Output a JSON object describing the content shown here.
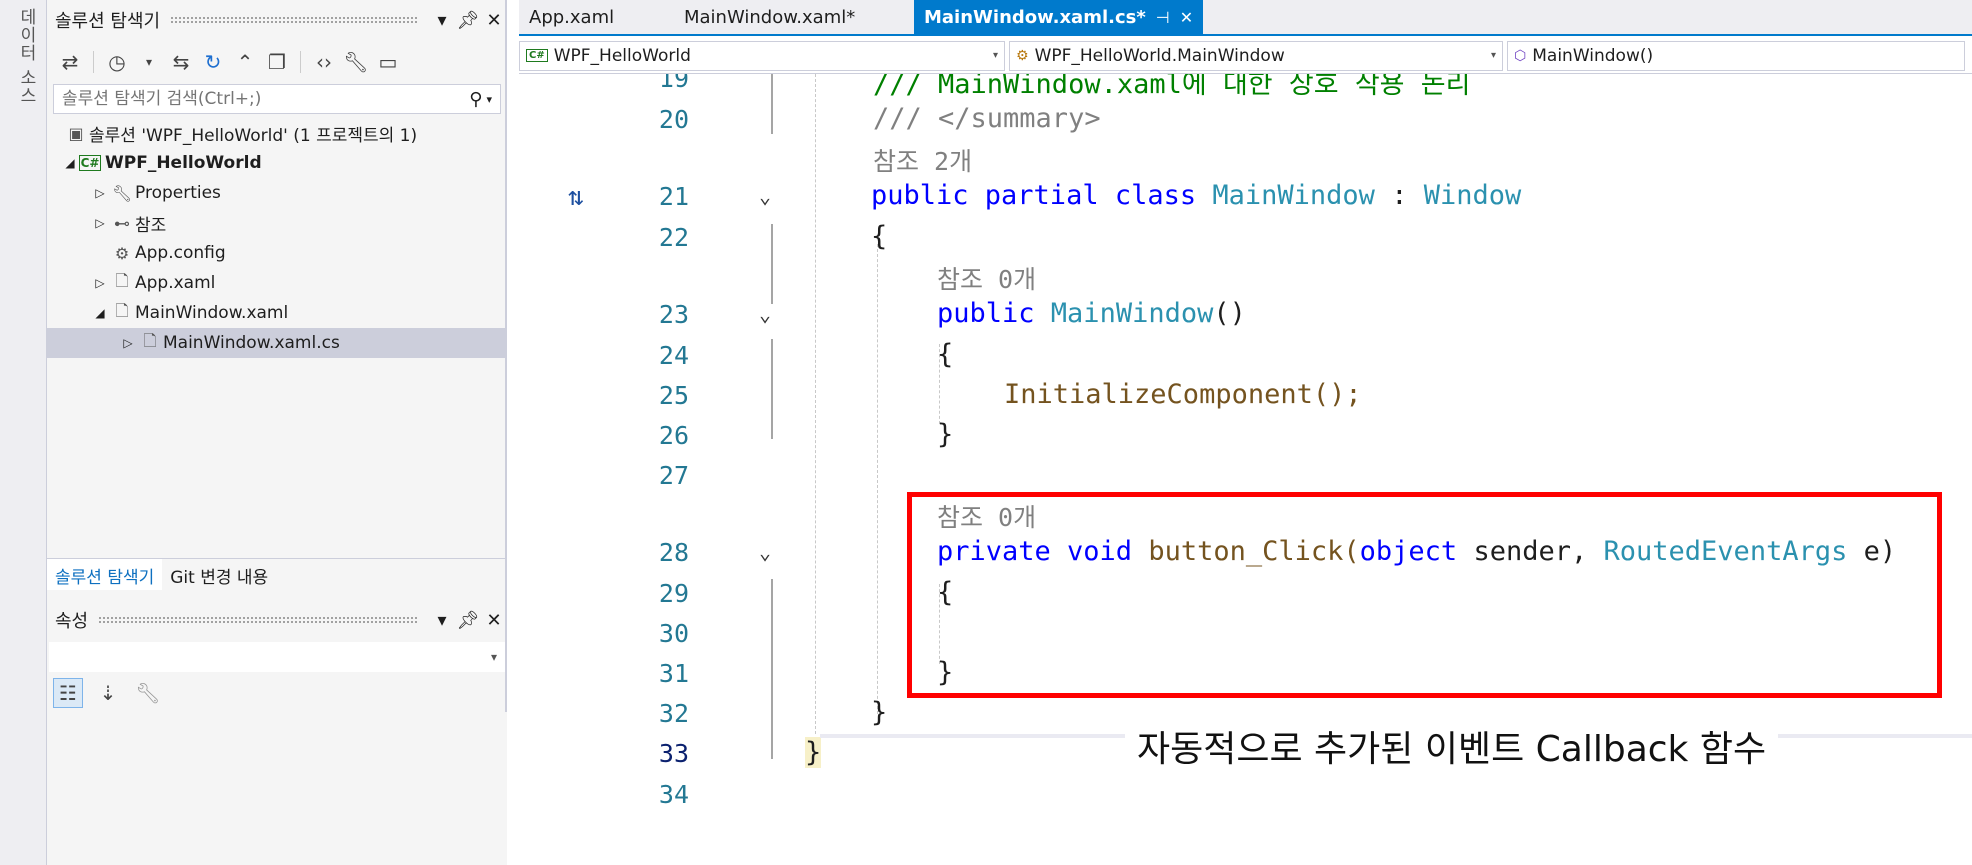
{
  "left_strip": {
    "label": "데이터 소스"
  },
  "solution_explorer": {
    "title": "솔루션 탐색기",
    "toolbar_icons": [
      "switch-views-icon",
      "history-icon",
      "sync-icon",
      "refresh-icon",
      "collapse-all-icon",
      "show-all-files-icon",
      "code-view-icon",
      "properties-wrench-icon",
      "preview-icon"
    ],
    "search_placeholder": "솔루션 탐색기 검색(Ctrl+;)",
    "tree": [
      {
        "label": "솔루션 'WPF_HelloWorld' (1 프로젝트의 1)",
        "icon": "solution-icon"
      },
      {
        "label": "WPF_HelloWorld",
        "icon": "csharp-project-icon",
        "bold": true
      },
      {
        "label": "Properties",
        "icon": "wrench-icon"
      },
      {
        "label": "참조",
        "icon": "references-icon"
      },
      {
        "label": "App.config",
        "icon": "config-file-icon"
      },
      {
        "label": "App.xaml",
        "icon": "xaml-file-icon"
      },
      {
        "label": "MainWindow.xaml",
        "icon": "xaml-file-icon"
      },
      {
        "label": "MainWindow.xaml.cs",
        "icon": "cs-file-icon",
        "selected": true
      }
    ],
    "tabs": [
      "솔루션 탐색기",
      "Git 변경 내용"
    ]
  },
  "properties_panel": {
    "title": "속성"
  },
  "editor": {
    "tabs": [
      {
        "label": "App.xaml",
        "active": false
      },
      {
        "label": "MainWindow.xaml*",
        "active": false
      },
      {
        "label": "MainWindow.xaml.cs*",
        "active": true
      }
    ],
    "nav": {
      "project": "WPF_HelloWorld",
      "type": "WPF_HelloWorld.MainWindow",
      "member": "MainWindow()"
    },
    "line_numbers": [
      "19",
      "20",
      "21",
      "22",
      "23",
      "24",
      "25",
      "26",
      "27",
      "28",
      "29",
      "30",
      "31",
      "32",
      "33",
      "34"
    ],
    "codelens": {
      "class_refs": "참조 2개",
      "ctor_refs": "참조 0개",
      "method_refs": "참조 0개"
    },
    "code": {
      "l19": "/// MainWindow.xaml에 대한 상호 작용 논리",
      "l20": "/// </summary>",
      "l21_kw": "public partial class ",
      "l21_type": "MainWindow",
      "l21_sep": " : ",
      "l21_base": "Window",
      "l22": "{",
      "l23_kw": "public ",
      "l23_name": "MainWindow",
      "l23_rest": "()",
      "l24": "{",
      "l25": "InitializeComponent();",
      "l26": "}",
      "l28_kw": "private void ",
      "l28_name": "button_Click(",
      "l28_obj": "object",
      "l28_sender": " sender, ",
      "l28_args": "RoutedEventArgs",
      "l28_end": " e)",
      "l29": "{",
      "l31": "}",
      "l32": "}",
      "l33": "}"
    },
    "annotation": "자동적으로 추가된 이벤트 Callback 함수",
    "highlight_color": "#ff0000"
  }
}
